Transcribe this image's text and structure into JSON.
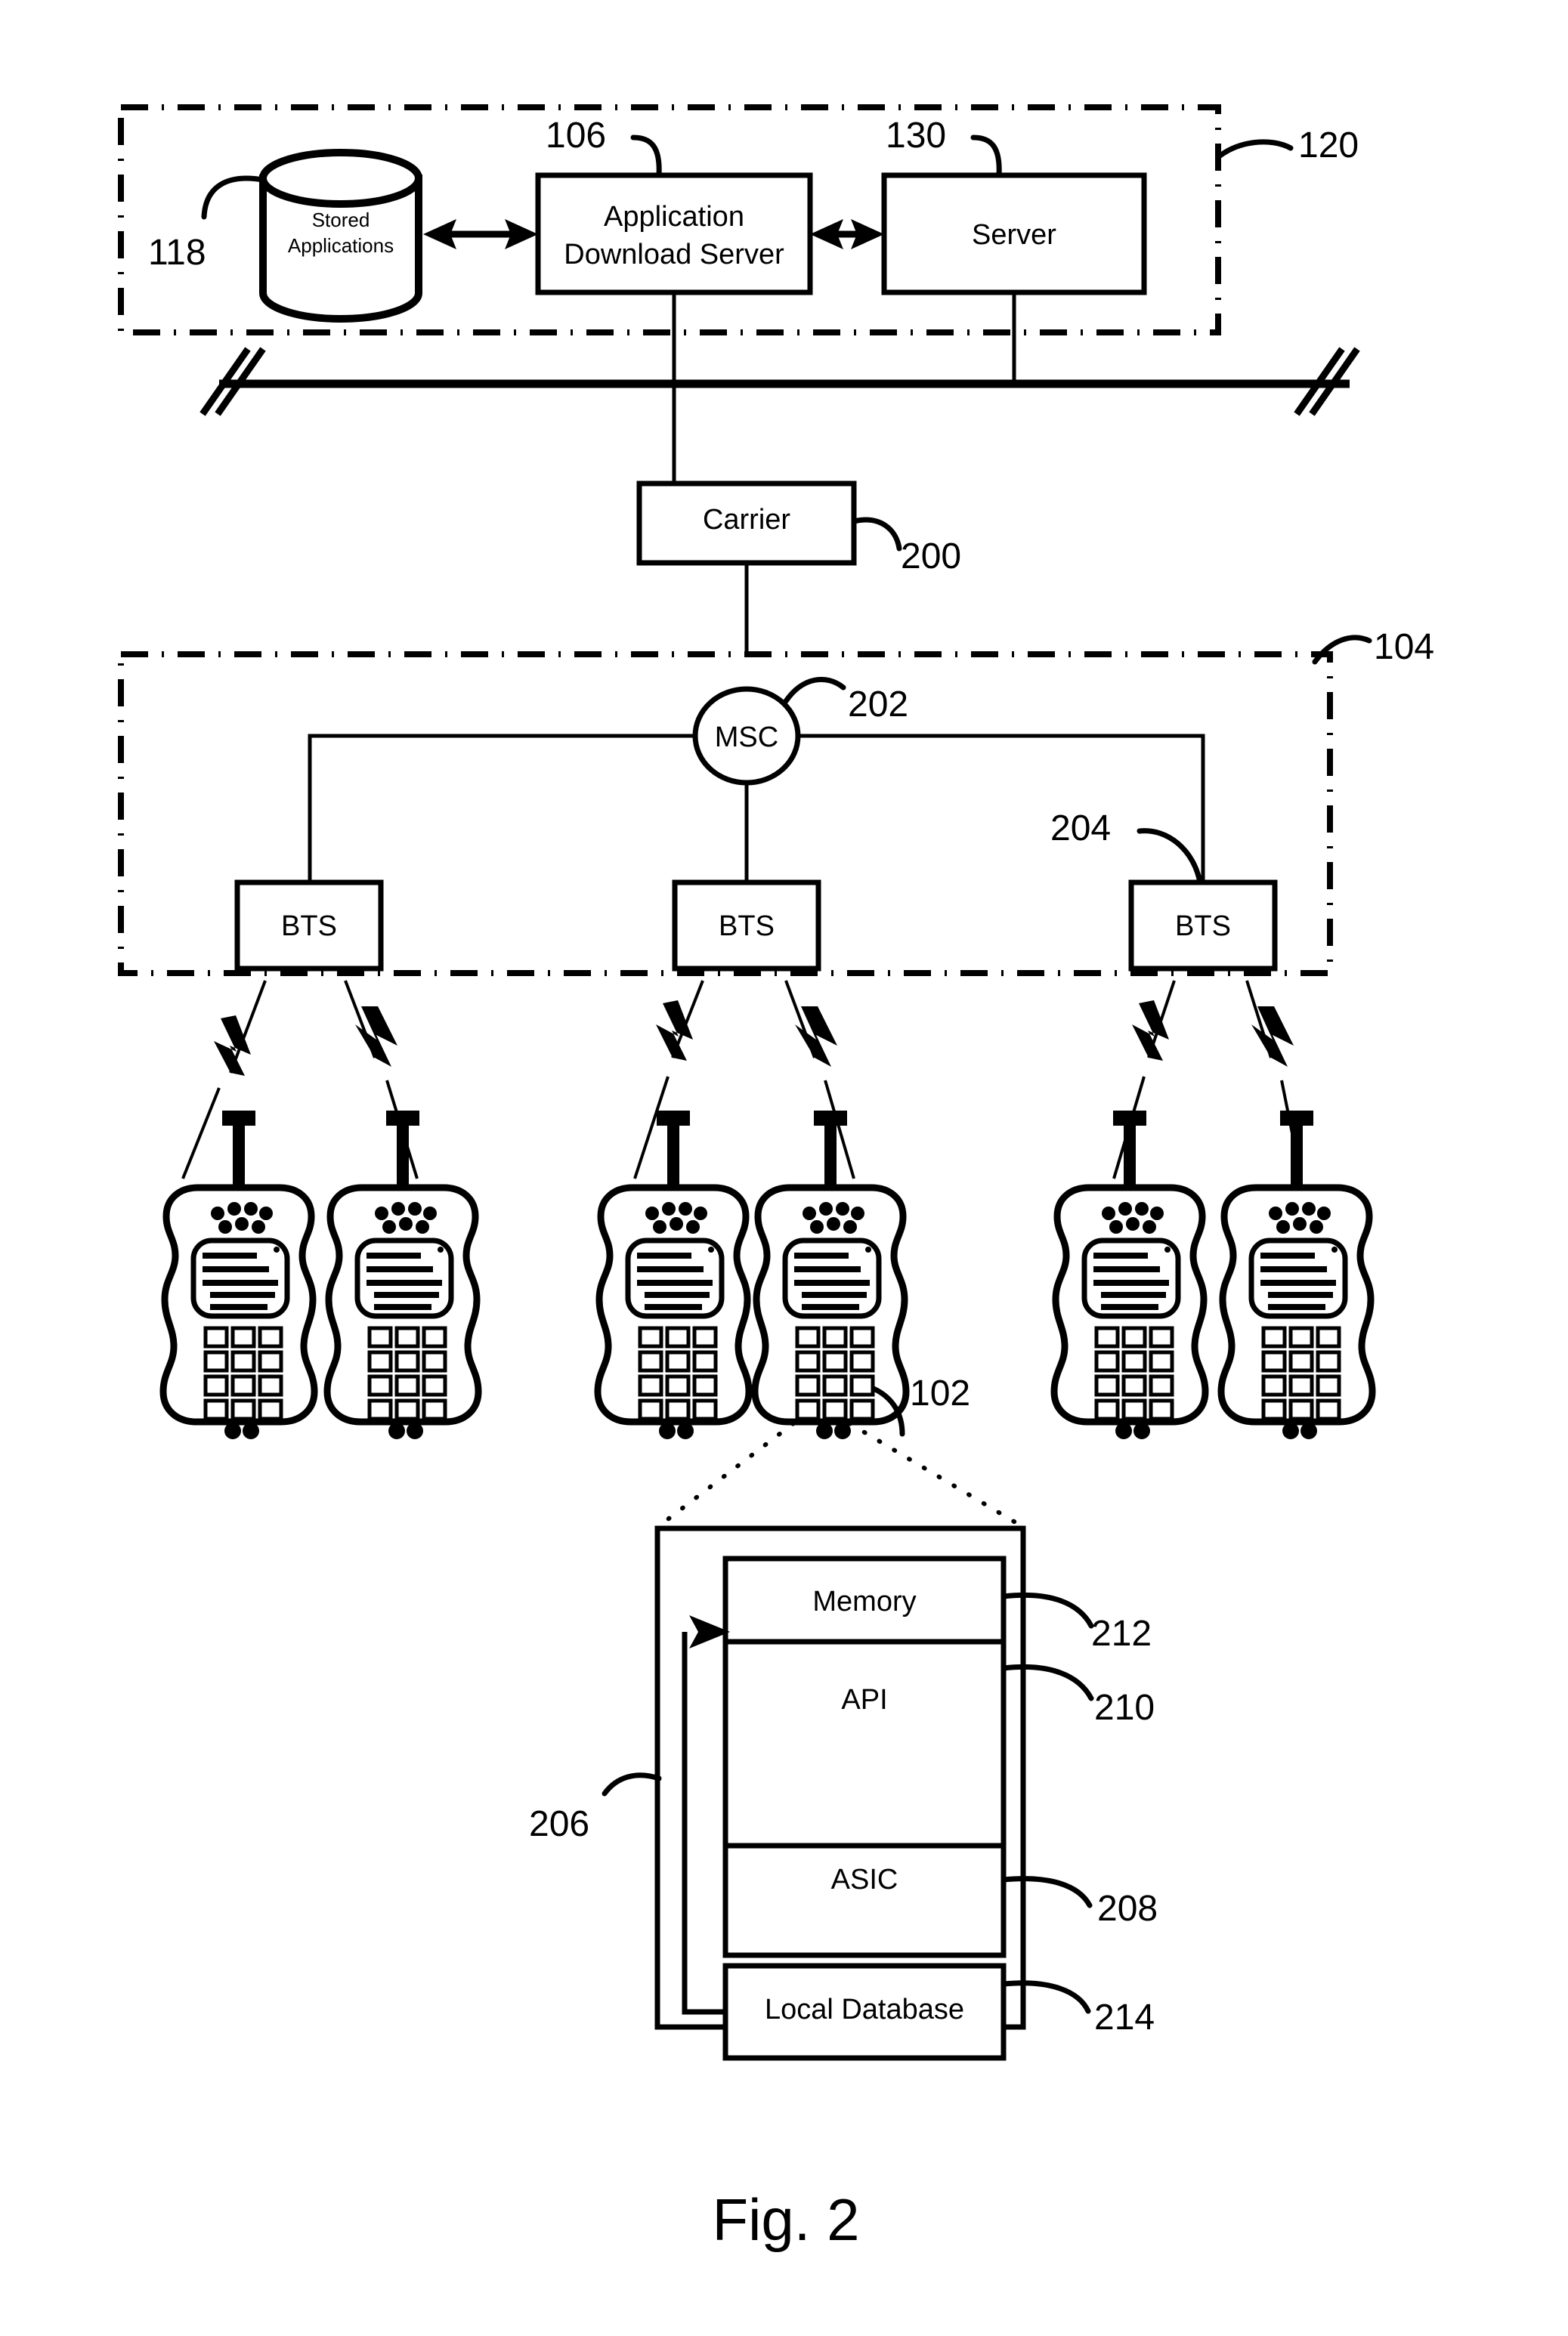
{
  "figure": {
    "caption": "Fig. 2",
    "domain_note": "patent-figure"
  },
  "network_backbone": {
    "label_120": "120",
    "nodes": [
      {
        "id": "118",
        "ref": "118",
        "name": "stored-applications-db",
        "label_line1": "Stored",
        "label_line2": "Applications",
        "shape": "cylinder"
      },
      {
        "id": "106",
        "ref": "106",
        "name": "application-download-server",
        "label_line1": "Application",
        "label_line2": "Download Server",
        "shape": "rect"
      },
      {
        "id": "130",
        "ref": "130",
        "name": "server",
        "label_line1": "Server",
        "label_line2": "",
        "shape": "rect"
      }
    ]
  },
  "carrier": {
    "label": "Carrier",
    "ref": "200"
  },
  "access_network": {
    "ref": "104",
    "msc": {
      "label": "MSC",
      "ref": "202"
    },
    "bts": [
      {
        "label": "BTS",
        "ref": ""
      },
      {
        "label": "BTS",
        "ref": ""
      },
      {
        "label": "BTS",
        "ref": "204"
      }
    ]
  },
  "handsets": {
    "ref": "102",
    "count": 6,
    "label": "mobile-handset"
  },
  "device_detail": {
    "outer_ref": "206",
    "blocks": [
      {
        "label": "Memory",
        "ref": "212"
      },
      {
        "label": "API",
        "ref": "210"
      },
      {
        "label": "ASIC",
        "ref": "208"
      },
      {
        "label": "Local Database",
        "ref": "214"
      }
    ]
  },
  "colors": {
    "ink": "#000000",
    "paper": "#ffffff"
  }
}
